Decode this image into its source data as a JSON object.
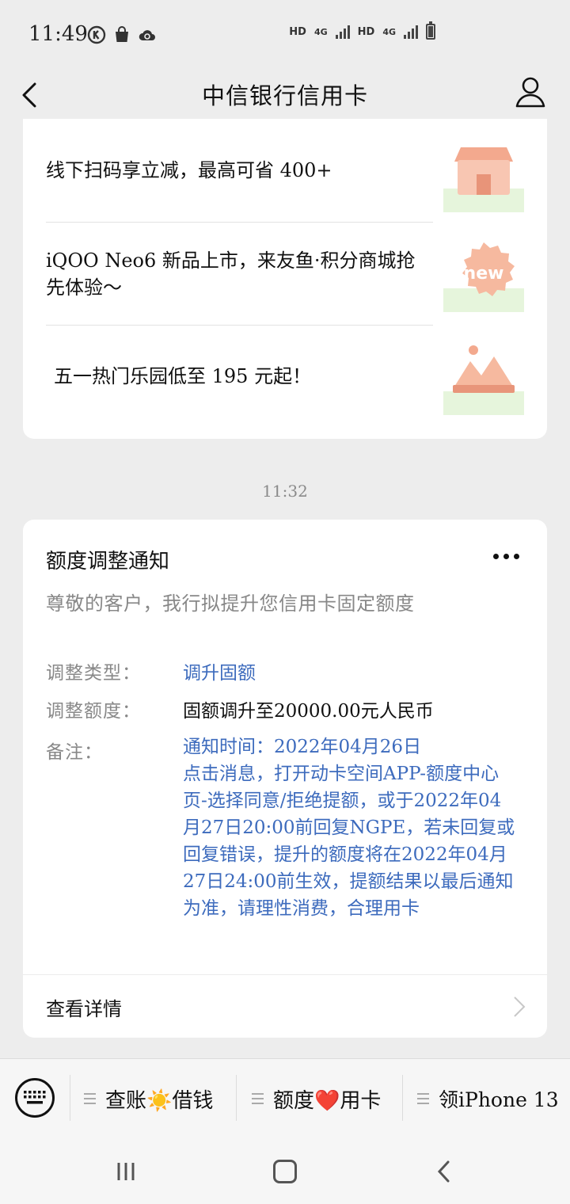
{
  "status_bar": {
    "time": "11:49",
    "network_left": "HD",
    "network_left_gen": "4G",
    "network_right": "HD",
    "network_right_gen": "4G",
    "icons": [
      "k-circle-icon",
      "shopping-bag-icon",
      "cloud-sync-icon",
      "signal-icon",
      "battery-icon"
    ]
  },
  "nav": {
    "title": "中信银行信用卡",
    "back_icon": "back-arrow-icon",
    "profile_icon": "person-icon"
  },
  "promos": [
    {
      "text": "线下扫码享立减，最高可省 400+",
      "icon": "store-icon"
    },
    {
      "text": "iQOO Neo6 新品上市，来友鱼·积分商城抢先体验～",
      "icon": "new-badge-icon"
    },
    {
      "text": "五一热门乐园低至 195 元起！",
      "icon": "mountain-image-icon"
    }
  ],
  "timestamp": "11:32",
  "notice": {
    "title": "额度调整通知",
    "subtitle": "尊敬的客户，我行拟提升您信用卡固定额度",
    "rows": [
      {
        "label": "调整类型：",
        "value": "调升固额"
      },
      {
        "label": "调整额度：",
        "value": "固额调升至20000.00元人民币"
      },
      {
        "label": "备注：",
        "value": "通知时间：2022年04月26日"
      }
    ],
    "remark_body": "点击消息，打开动卡空间APP-额度中心页-选择同意/拒绝提额，或于2022年04月27日20:00前回复NGPE，若未回复或回复错误，提升的额度将在2022年04月27日24:00前生效，提额结果以最后通知为准，请理性消费，合理用卡",
    "detail_label": "查看详情"
  },
  "bottom_menu": {
    "keyboard_icon": "keyboard-icon",
    "items": [
      {
        "label": "查账☀️借钱"
      },
      {
        "label": "额度❤️用卡"
      },
      {
        "label": "领iPhone 13"
      }
    ]
  },
  "colors": {
    "background": "#ededed",
    "card": "#ffffff",
    "link_blue": "#3d6bbd",
    "muted": "#888888",
    "thumb_peach": "#f5b79e",
    "thumb_green": "#e6f5dc"
  }
}
